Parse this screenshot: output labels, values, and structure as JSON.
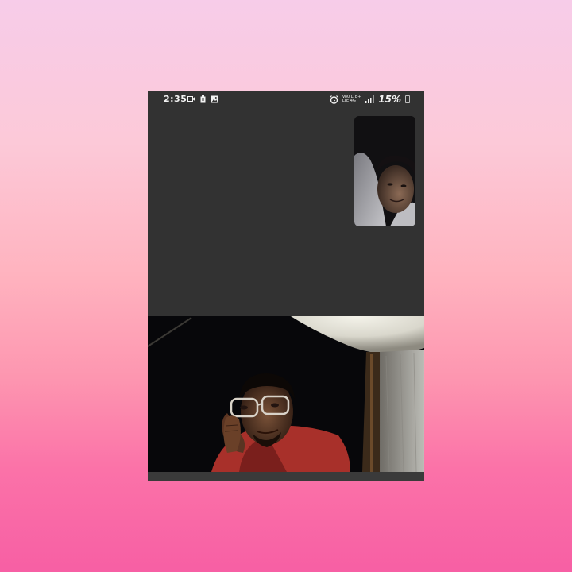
{
  "status_bar": {
    "time": "2:35",
    "left_icons": [
      "video-recorder-icon",
      "battery-saver-icon",
      "gallery-icon"
    ],
    "right_icons": [
      "alarm-icon",
      "volte-icon",
      "signal-icon",
      "battery-icon"
    ],
    "network_line1": "Vo0 LTE+",
    "network_line2": "LTE 4G",
    "battery": "15%"
  },
  "call": {
    "self_preview": "local-camera-preview",
    "main_feed": "remote-camera-feed"
  },
  "colors": {
    "phone_bg": "#323232",
    "status_text": "#f2f2f2",
    "shirt_red": "#b33a32"
  }
}
